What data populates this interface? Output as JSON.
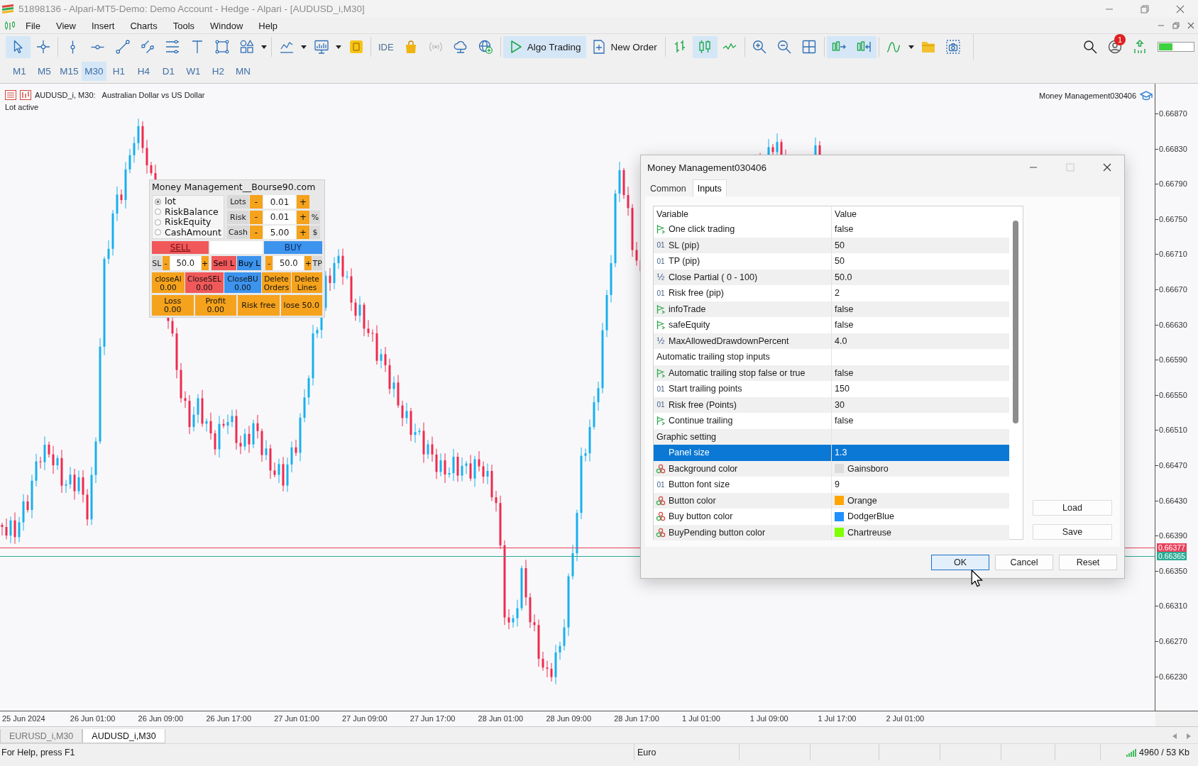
{
  "window": {
    "title": "51898136 - Alpari-MT5-Demo: Demo Account - Hedge - Alpari - [AUDUSD_i,M30]"
  },
  "menu": [
    "File",
    "View",
    "Insert",
    "Charts",
    "Tools",
    "Window",
    "Help"
  ],
  "toolbar": {
    "groups": [
      [
        {
          "kind": "cursor",
          "selected": true
        },
        {
          "kind": "crosshair",
          "selected": false
        }
      ],
      [
        {
          "kind": "vline",
          "selected": false
        },
        {
          "kind": "hline",
          "selected": false
        },
        {
          "kind": "trendline",
          "selected": false
        },
        {
          "kind": "channel",
          "selected": false
        },
        {
          "kind": "levels",
          "selected": false
        },
        {
          "kind": "text",
          "selected": false
        },
        {
          "kind": "rectangle",
          "selected": false
        },
        {
          "kind": "shapes",
          "selected": false
        },
        {
          "kind": "caret",
          "selected": false
        }
      ],
      [
        {
          "kind": "indicators",
          "selected": false
        },
        {
          "kind": "caret",
          "selected": false
        },
        {
          "kind": "templates",
          "selected": false
        },
        {
          "kind": "caret",
          "selected": false
        },
        {
          "kind": "coin",
          "selected": false
        }
      ],
      [
        {
          "kind": "label",
          "label": "IDE",
          "selected": false
        },
        {
          "kind": "bag",
          "selected": false
        },
        {
          "kind": "signals",
          "selected": false
        },
        {
          "kind": "cloud",
          "selected": false
        },
        {
          "kind": "globe",
          "selected": false
        }
      ],
      [
        {
          "kind": "algo",
          "label": "Algo Trading",
          "selected": true
        },
        {
          "kind": "order",
          "label": "New Order",
          "selected": false
        }
      ],
      [
        {
          "kind": "bars",
          "selected": false
        },
        {
          "kind": "candles",
          "selected": true
        },
        {
          "kind": "line",
          "selected": false
        }
      ],
      [
        {
          "kind": "zoomin",
          "selected": false
        },
        {
          "kind": "zoomout",
          "selected": false
        },
        {
          "kind": "tile",
          "selected": false
        }
      ],
      [
        {
          "kind": "autoscroll",
          "selected": true
        },
        {
          "kind": "shift",
          "selected": true
        }
      ],
      [
        {
          "kind": "functions",
          "selected": false
        },
        {
          "kind": "caret",
          "selected": false
        },
        {
          "kind": "folder",
          "selected": false
        },
        {
          "kind": "screenshot",
          "selected": false
        }
      ]
    ]
  },
  "status_icons": {
    "notifications": "1"
  },
  "timeframes": [
    {
      "label": "M1",
      "selected": false
    },
    {
      "label": "M5",
      "selected": false
    },
    {
      "label": "M15",
      "selected": false
    },
    {
      "label": "M30",
      "selected": true
    },
    {
      "label": "H1",
      "selected": false
    },
    {
      "label": "H4",
      "selected": false
    },
    {
      "label": "D1",
      "selected": false
    },
    {
      "label": "W1",
      "selected": false
    },
    {
      "label": "H2",
      "selected": false
    },
    {
      "label": "MN",
      "selected": false
    }
  ],
  "chart": {
    "symbol": "AUDUSD_i, M30:",
    "description": "Australian Dollar vs US Dollar",
    "status": "Lot active",
    "expert": "Money Management030406",
    "price_ticks": [
      "0.66870",
      "0.66830",
      "0.66790",
      "0.66750",
      "0.66710",
      "0.66670",
      "0.66630",
      "0.66590",
      "0.66550",
      "0.66510",
      "0.66470",
      "0.66430",
      "0.66390",
      "0.66350",
      "0.66310",
      "0.66270",
      "0.66230"
    ],
    "price_tags": [
      {
        "label": "0.66377",
        "color": "#e8415a"
      },
      {
        "label": "0.66365",
        "color": "#2bab94"
      }
    ],
    "time_ticks": [
      "25 Jun 2024",
      "26 Jun 01:00",
      "26 Jun 09:00",
      "26 Jun 17:00",
      "27 Jun 01:00",
      "27 Jun 09:00",
      "27 Jun 17:00",
      "28 Jun 01:00",
      "28 Jun 09:00",
      "28 Jun 17:00",
      "1 Jul 01:00",
      "1 Jul 09:00",
      "1 Jul 17:00",
      "2 Jul 01:00"
    ]
  },
  "panel": {
    "title": "Money Management__Bourse90.com",
    "modes": [
      {
        "label": "lot",
        "selected": true
      },
      {
        "label": "RiskBalance",
        "selected": false
      },
      {
        "label": "RiskEquity",
        "selected": false
      },
      {
        "label": "CashAmount",
        "selected": false
      }
    ],
    "steppers": [
      {
        "label": "Lots",
        "minus": "-",
        "value": "0.01",
        "plus": "+"
      },
      {
        "label": "Risk",
        "minus": "-",
        "value": "0.01",
        "plus": "+",
        "unit": "%"
      },
      {
        "label": "Cash",
        "minus": "-",
        "value": "5.00",
        "plus": "+",
        "unit": "$"
      }
    ],
    "sell": "SELL",
    "buy": "BUY",
    "pending": {
      "sl_label": "SL",
      "sl_minus": "-",
      "sl_value": "50.0",
      "sl_plus": "+",
      "sell_limit": "Sell L",
      "buy_limit": "Buy L",
      "tp_minus": "-",
      "tp_value": "50.0",
      "tp_plus": "+",
      "tp_label": "TP"
    },
    "close_buttons": [
      {
        "label": "closeAl",
        "value": "0.00",
        "color": "#f5a21c"
      },
      {
        "label": "CloseSEL",
        "value": "0.00",
        "color": "#f0585a"
      },
      {
        "label": "CloseBU",
        "value": "0.00",
        "color": "#3c94ee"
      },
      {
        "label": "Delete Orders",
        "color": "#f5a21c"
      },
      {
        "label": "Delete Lines",
        "color": "#f5a21c"
      }
    ],
    "summary": [
      {
        "label": "Loss",
        "value": "0.00"
      },
      {
        "label": "Profit",
        "value": "0.00"
      },
      {
        "label": "Risk free"
      },
      {
        "label": "lose 50.0"
      }
    ]
  },
  "dialog": {
    "title": "Money Management030406",
    "tabs": [
      {
        "label": "Common",
        "selected": false
      },
      {
        "label": "Inputs",
        "selected": true
      }
    ],
    "columns": [
      "Variable",
      "Value"
    ],
    "rows": [
      {
        "kind": "bool",
        "name": "One click trading",
        "value": "false",
        "selected": false
      },
      {
        "kind": "int",
        "glyph": "01",
        "name": "SL (pip)",
        "value": "50",
        "selected": false
      },
      {
        "kind": "int",
        "glyph": "01",
        "name": "TP (pip)",
        "value": "50",
        "selected": false
      },
      {
        "kind": "double",
        "glyph": "½",
        "name": "Close Partial ( 0 - 100)",
        "value": "50.0",
        "selected": false
      },
      {
        "kind": "int",
        "glyph": "01",
        "name": "Risk free (pip)",
        "value": "2",
        "selected": false
      },
      {
        "kind": "bool",
        "name": "infoTrade",
        "value": "false",
        "selected": false
      },
      {
        "kind": "bool",
        "name": "safeEquity",
        "value": "false",
        "selected": false
      },
      {
        "kind": "double",
        "glyph": "½",
        "name": "MaxAllowedDrawdownPercent",
        "value": "4.0",
        "selected": false
      },
      {
        "kind": "group",
        "name": "Automatic trailing stop inputs",
        "selected": false
      },
      {
        "kind": "bool",
        "name": "Automatic trailing stop false or true",
        "value": "false",
        "selected": false
      },
      {
        "kind": "int",
        "glyph": "01",
        "name": "Start trailing points",
        "value": "150",
        "selected": false
      },
      {
        "kind": "int",
        "glyph": "01",
        "name": "Risk free (Points)",
        "value": "30",
        "selected": false
      },
      {
        "kind": "bool",
        "name": "Continue trailing",
        "value": "false",
        "selected": false
      },
      {
        "kind": "group",
        "name": "Graphic setting",
        "selected": false
      },
      {
        "kind": "plain",
        "name": "Panel size",
        "value": "1.3",
        "selected": true
      },
      {
        "kind": "color",
        "name": "Background color",
        "value": "Gainsboro",
        "color": "#dcdcdc",
        "selected": false
      },
      {
        "kind": "int",
        "glyph": "01",
        "name": "Button font size",
        "value": "9",
        "selected": false
      },
      {
        "kind": "color",
        "name": "Button color",
        "value": "Orange",
        "color": "#ffa500",
        "selected": false
      },
      {
        "kind": "color",
        "name": "Buy button color",
        "value": "DodgerBlue",
        "color": "#1e90ff",
        "selected": false
      },
      {
        "kind": "color",
        "name": "BuyPending button color",
        "value": "Chartreuse",
        "color": "#7fff00",
        "selected": false
      }
    ],
    "side_buttons": [
      "Load",
      "Save"
    ],
    "buttons": [
      {
        "label": "OK",
        "default": true
      },
      {
        "label": "Cancel",
        "default": false
      },
      {
        "label": "Reset",
        "default": false
      }
    ]
  },
  "chart_tabs": [
    {
      "label": "EURUSD_i,M30",
      "selected": false
    },
    {
      "label": "AUDUSD_i,M30",
      "selected": true
    }
  ],
  "status_bar": {
    "help": "For Help, press F1",
    "language": "Euro",
    "traffic": "4960 / 53 Kb"
  }
}
